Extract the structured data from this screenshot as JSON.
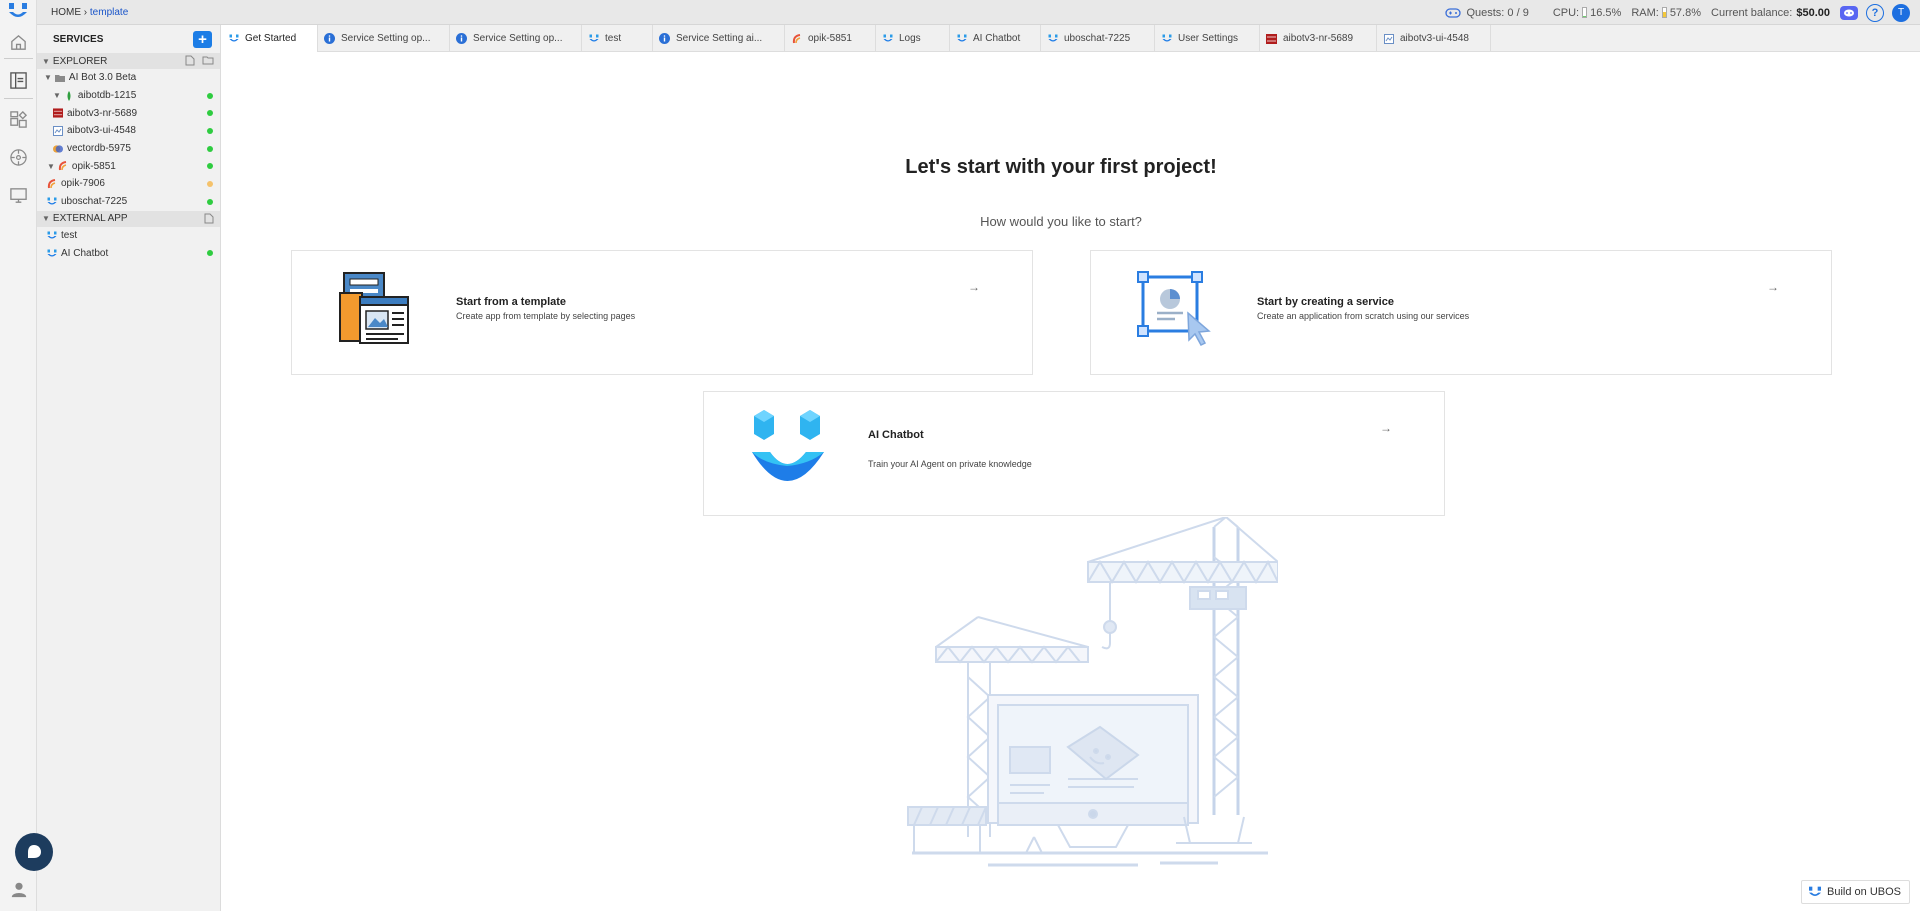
{
  "topbar": {
    "breadcrumb_home": "HOME",
    "breadcrumb_sep": "›",
    "breadcrumb_current": "template",
    "quests": "Quests: 0 / 9",
    "cpu_label": "CPU:",
    "cpu_value": "16.5%",
    "cpu_fraction": 0.165,
    "ram_label": "RAM:",
    "ram_value": "57.8%",
    "ram_fraction": 0.578,
    "balance_label": "Current balance:",
    "balance_value": "$50.00",
    "avatar_letter": "T",
    "help_glyph": "?"
  },
  "sidebar": {
    "title": "SERVICES",
    "add_glyph": "+",
    "explorer_label": "EXPLORER",
    "explorer_items": [
      {
        "label": "AI Bot 3.0 Beta",
        "icon": "folder-icon",
        "status": ""
      },
      {
        "label": "aibotdb-1215",
        "icon": "db-icon",
        "status": "#2ecc40"
      },
      {
        "label": "aibotv3-nr-5689",
        "icon": "nodered-icon",
        "status": "#2ecc40"
      },
      {
        "label": "aibotv3-ui-4548",
        "icon": "ui-icon",
        "status": "#2ecc40"
      },
      {
        "label": "vectordb-5975",
        "icon": "vectordb-icon",
        "status": "#2ecc40"
      },
      {
        "label": "opik-5851",
        "icon": "opik-icon",
        "status": "#2ecc40"
      },
      {
        "label": "opik-7906",
        "icon": "opik-icon",
        "status": "#f5c26b"
      },
      {
        "label": "uboschat-7225",
        "icon": "ubos-icon",
        "status": "#2ecc40"
      }
    ],
    "external_label": "EXTERNAL APP",
    "external_items": [
      {
        "label": "test",
        "icon": "ubos-icon",
        "status": ""
      },
      {
        "label": "AI Chatbot",
        "icon": "ubos-icon",
        "status": "#2ecc40"
      }
    ]
  },
  "tabs": [
    {
      "label": "Get Started",
      "icon": "ubos-icon",
      "active": true
    },
    {
      "label": "Service Setting op...",
      "icon": "info-icon",
      "active": false
    },
    {
      "label": "Service Setting op...",
      "icon": "info-icon",
      "active": false
    },
    {
      "label": "test",
      "icon": "ubos-icon",
      "active": false
    },
    {
      "label": "Service Setting ai...",
      "icon": "info-icon",
      "active": false
    },
    {
      "label": "opik-5851",
      "icon": "opik-icon",
      "active": false
    },
    {
      "label": "Logs",
      "icon": "logs-icon",
      "active": false
    },
    {
      "label": "AI Chatbot",
      "icon": "ubos-icon",
      "active": false
    },
    {
      "label": "uboschat-7225",
      "icon": "ubos-icon",
      "active": false
    },
    {
      "label": "User Settings",
      "icon": "ubos-icon",
      "active": false
    },
    {
      "label": "aibotv3-nr-5689",
      "icon": "nodered-icon",
      "active": false
    },
    {
      "label": "aibotv3-ui-4548",
      "icon": "ui-icon",
      "active": false
    }
  ],
  "main": {
    "title": "Let's start with your first project!",
    "subtitle": "How would you like to start?",
    "cards": {
      "template": {
        "title": "Start from a template",
        "desc": "Create app from template by selecting pages",
        "arrow": "→"
      },
      "service": {
        "title": "Start by creating a service",
        "desc": "Create an application from scratch using our services",
        "arrow": "→"
      },
      "chatbot": {
        "title": "AI Chatbot",
        "desc": "Train your AI Agent on private knowledge",
        "arrow": "→"
      }
    },
    "build_label": "Build on UBOS"
  },
  "colors": {
    "accent": "#1c7de6",
    "ok": "#2ecc40",
    "warn": "#f5c26b"
  }
}
